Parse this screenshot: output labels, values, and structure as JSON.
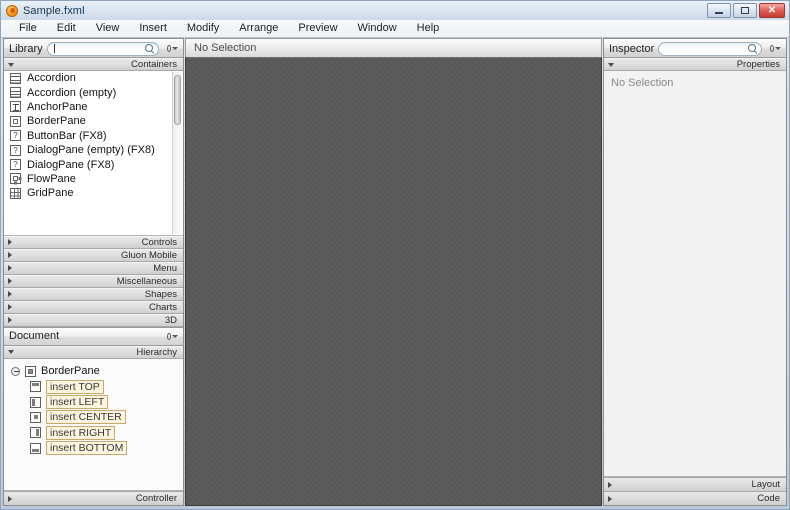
{
  "window": {
    "title": "Sample.fxml",
    "app_icon": "scene-builder-icon",
    "controls": {
      "minimize": "minimize-icon",
      "maximize": "maximize-icon",
      "close": "close-icon",
      "close_color": "#c33a2d"
    }
  },
  "menubar": {
    "items": [
      "File",
      "Edit",
      "View",
      "Insert",
      "Modify",
      "Arrange",
      "Preview",
      "Window",
      "Help"
    ]
  },
  "library": {
    "title": "Library",
    "search_value": "",
    "search_placeholder": "",
    "gear_label": "library-options",
    "expanded_category": "Containers",
    "items": [
      {
        "label": "Accordion",
        "icon": "accordion-icon"
      },
      {
        "label": "Accordion  (empty)",
        "icon": "accordion-icon"
      },
      {
        "label": "AnchorPane",
        "icon": "anchor-pane-icon"
      },
      {
        "label": "BorderPane",
        "icon": "border-pane-icon"
      },
      {
        "label": "ButtonBar  (FX8)",
        "icon": "unknown-icon"
      },
      {
        "label": "DialogPane (empty)  (FX8)",
        "icon": "unknown-icon"
      },
      {
        "label": "DialogPane  (FX8)",
        "icon": "unknown-icon"
      },
      {
        "label": "FlowPane",
        "icon": "flow-pane-icon"
      },
      {
        "label": "GridPane",
        "icon": "grid-pane-icon"
      }
    ],
    "categories": [
      "Controls",
      "Gluon Mobile",
      "Menu",
      "Miscellaneous",
      "Shapes",
      "Charts",
      "3D"
    ],
    "footer": "Controller"
  },
  "document": {
    "title": "Document",
    "gear_label": "document-options",
    "section": "Hierarchy",
    "tree": {
      "root": {
        "label": "BorderPane",
        "icon": "border-pane-icon",
        "expanded": true
      },
      "children": [
        {
          "label": "insert TOP",
          "icon": "region-top-icon",
          "placeholder": true
        },
        {
          "label": "insert LEFT",
          "icon": "region-left-icon",
          "placeholder": true
        },
        {
          "label": "insert CENTER",
          "icon": "region-center-icon",
          "placeholder": true
        },
        {
          "label": "insert RIGHT",
          "icon": "region-right-icon",
          "placeholder": true
        },
        {
          "label": "insert BOTTOM",
          "icon": "region-bottom-icon",
          "placeholder": true
        }
      ]
    }
  },
  "canvas": {
    "status": "No Selection",
    "background_color": "#585858"
  },
  "inspector": {
    "title": "Inspector",
    "search_value": "",
    "gear_label": "inspector-options",
    "section": "Properties",
    "empty_text": "No Selection",
    "sections": [
      "Layout",
      "Code"
    ]
  }
}
